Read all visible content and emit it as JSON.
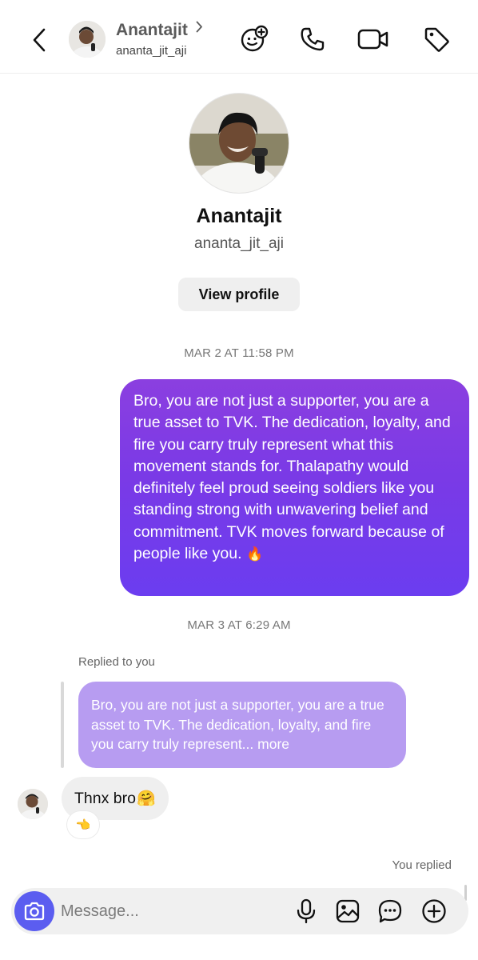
{
  "header": {
    "name": "Anantajit",
    "username": "ananta_jit_aji",
    "icons": [
      "back-chevron-icon",
      "avatar",
      "chevron-right-icon",
      "sticker-effect-icon",
      "phone-icon",
      "video-camera-icon",
      "tag-icon"
    ]
  },
  "profile": {
    "name": "Anantajit",
    "username": "ananta_jit_aji",
    "view_profile_label": "View profile"
  },
  "timestamps": {
    "first": "MAR 2 AT 11:58 PM",
    "second": "MAR 3 AT 6:29 AM"
  },
  "messages": {
    "outgoing_text": "Bro, you are not just a supporter, you are a true asset to TVK. The dedication, loyalty, and fire you carry truly represent what this movement stands for. Thalapathy would definitely feel proud seeing soldiers like you standing strong with unwavering belief and commitment. TVK moves forward because of people like you.",
    "outgoing_emoji": "🔥",
    "replied_label": "Replied to you",
    "reply_preview": "Bro, you are not just a supporter, you are a true asset to TVK. The dedication, loyalty, and fire you carry truly represent... more",
    "incoming_text": "Thnx bro",
    "incoming_emoji": "🤗",
    "reaction_emoji": "👈",
    "you_replied": "You replied"
  },
  "composer": {
    "placeholder": "Message...",
    "icons": [
      "camera-icon",
      "microphone-icon",
      "gallery-icon",
      "sticker-chat-icon",
      "plus-icon"
    ]
  },
  "colors": {
    "outgoing_bubble_top": "#8b3fe0",
    "outgoing_bubble_bottom": "#6b3df0",
    "reply_bubble": "#b79cf1",
    "camera_button": "#5b5df0",
    "incoming_bubble": "#efefef"
  }
}
